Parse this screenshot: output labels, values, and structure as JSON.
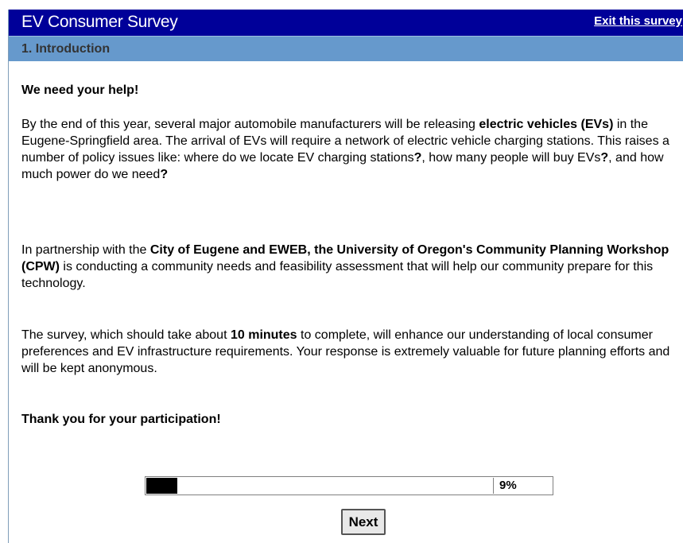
{
  "header": {
    "title": "EV Consumer Survey",
    "exit_label": "Exit this survey"
  },
  "section": {
    "title": "1. Introduction"
  },
  "content": {
    "heading": "We need your help!",
    "p1": [
      "By the end of this year, several major automobile manufacturers will be releasing ",
      "electric vehicles (EVs)",
      " in the Eugene-Springfield area. The arrival of EVs will require a network of electric vehicle charging stations. This raises a number of policy issues like: where do we locate EV charging stations",
      "?",
      ", how many people will buy EVs",
      "?",
      ", and how much power do we need",
      "?"
    ],
    "p2": [
      "In partnership with the ",
      "City of Eugene and EWEB, the University of Oregon's Community Planning Workshop (CPW)",
      " is conducting a community needs and feasibility assessment that will help our community prepare for this technology."
    ],
    "p3": [
      "The survey, which should take about ",
      "10 minutes",
      " to complete, will enhance our understanding of local consumer preferences and EV infrastructure requirements. Your response is extremely valuable for future planning efforts and will be kept anonymous."
    ],
    "closing": "Thank you for your participation!"
  },
  "progress": {
    "percent": 9,
    "label": "9%"
  },
  "navigation": {
    "next_label": "Next"
  },
  "colors": {
    "title_bar": "#000099",
    "section_bar": "#6699cc",
    "progress_fill": "#000000"
  }
}
